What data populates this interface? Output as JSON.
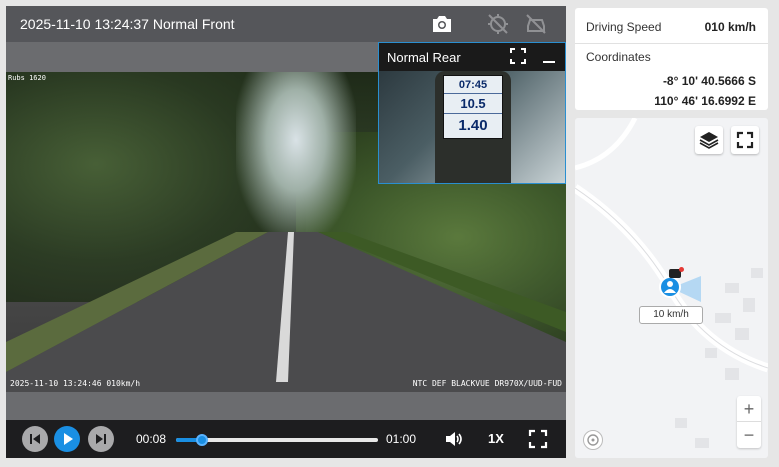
{
  "player": {
    "title": "2025-11-10 13:24:37 Normal Front",
    "icons": {
      "snapshot": "camera-icon",
      "gps": "gps-off-icon",
      "vehicle": "car-off-icon"
    },
    "video": {
      "stamp_top_left": "Rubs 1620",
      "stamp_bottom_left": "2025-11-10 13:24:46 010km/h",
      "stamp_bottom_right": "NTC DEF BLACKVUE DR970X/UUD-FUD"
    },
    "rear": {
      "label": "Normal Rear",
      "gps_rows": [
        "07:45",
        "10.5",
        "1.40"
      ]
    },
    "controls": {
      "current_time": "00:08",
      "total_time": "01:00",
      "progress": 0.13,
      "speed": "1X"
    }
  },
  "info": {
    "speed_label": "Driving Speed",
    "speed_value": "010 km/h",
    "coordinates_label": "Coordinates",
    "lat": "-8° 10' 40.5666 S",
    "lon": "110° 46' 16.6992 E"
  },
  "map": {
    "vehicle_speed": "10 km/h",
    "zoom_in": "+",
    "zoom_out": "−",
    "accent": "#1a8fe3"
  }
}
